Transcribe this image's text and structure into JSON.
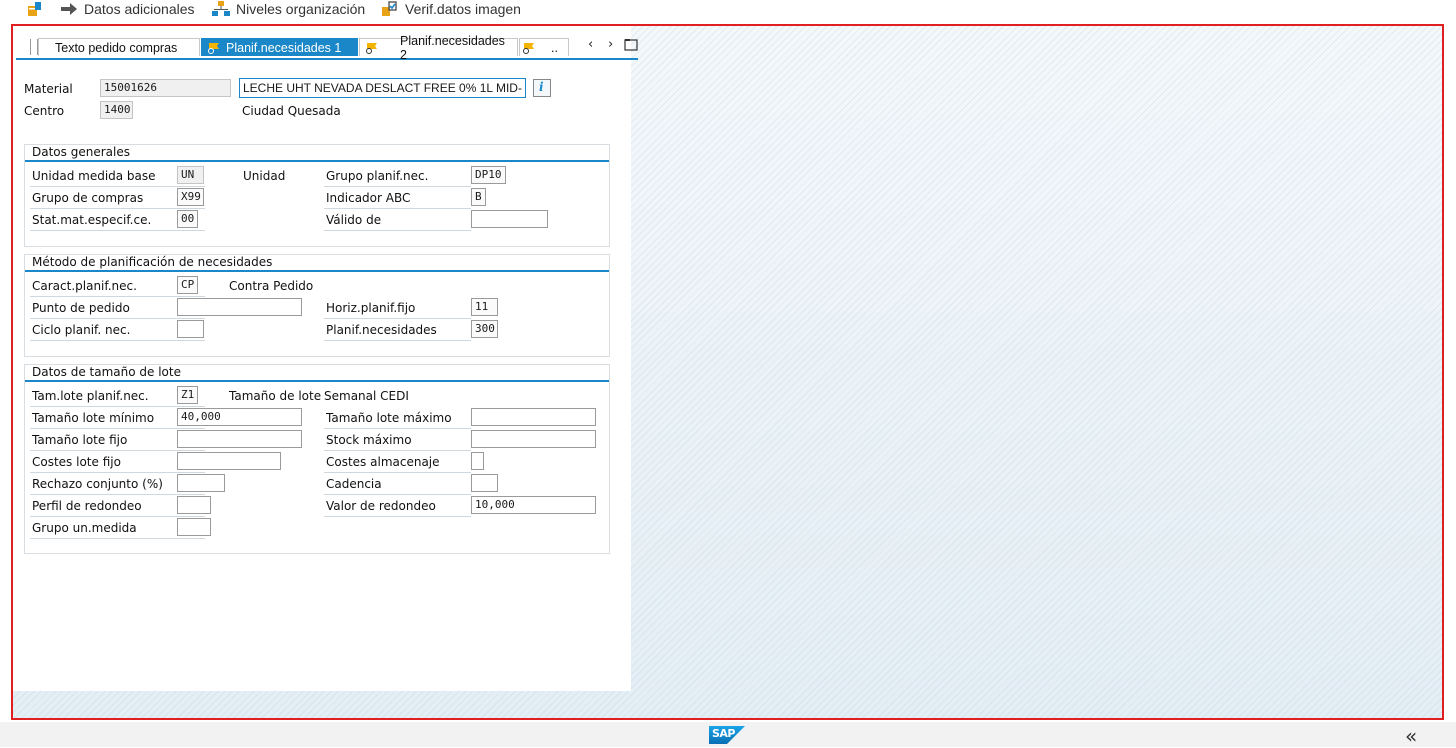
{
  "toolbar": {
    "btn0_label": "",
    "btn1_label": "Datos adicionales",
    "btn2_label": "Niveles organización",
    "btn3_label": "Verif.datos imagen"
  },
  "tabs": [
    {
      "label": "Texto pedido compras",
      "active": false
    },
    {
      "label": "Planif.necesidades 1",
      "active": true
    },
    {
      "label": "Planif.necesidades 2",
      "active": false
    },
    {
      "label": "..",
      "active": false
    }
  ],
  "header": {
    "material_label": "Material",
    "material_value": "15001626",
    "material_desc": "LECHE UHT NEVADA DESLACT FREE 0% 1L MID-",
    "centro_label": "Centro",
    "centro_value": "1400",
    "centro_desc": "Ciudad Quesada"
  },
  "datos_generales": {
    "title": "Datos generales",
    "umb_label": "Unidad medida base",
    "umb_value": "UN",
    "umb_desc": "Unidad",
    "gpn_label": "Grupo planif.nec.",
    "gpn_value": "DP10",
    "gc_label": "Grupo de compras",
    "gc_value": "X99",
    "abc_label": "Indicador ABC",
    "abc_value": "B",
    "stat_label": "Stat.mat.especif.ce.",
    "stat_value": "00",
    "valido_label": "Válido de",
    "valido_value": ""
  },
  "metodo": {
    "title": "Método de planificación de necesidades",
    "caract_label": "Caract.planif.nec.",
    "caract_value": "CP",
    "caract_desc": "Contra Pedido",
    "punto_label": "Punto de pedido",
    "punto_value": "",
    "horiz_label": "Horiz.planif.fijo",
    "horiz_value": "11",
    "ciclo_label": "Ciclo planif. nec.",
    "ciclo_value": "",
    "planif_label": "Planif.necesidades",
    "planif_value": "300"
  },
  "lote": {
    "title": "Datos de tamaño de lote",
    "tam_label": "Tam.lote planif.nec.",
    "tam_value": "Z1",
    "tam_desc_a": "Tamaño de lote",
    "tam_desc_b": "Semanal CEDI",
    "min_label": "Tamaño lote mínimo",
    "min_value": "40,000",
    "max_label": "Tamaño lote máximo",
    "max_value": "",
    "fijo_label": "Tamaño lote fijo",
    "fijo_value": "",
    "stock_label": "Stock máximo",
    "stock_value": "",
    "costes_label": "Costes lote fijo",
    "costes_value": "",
    "alm_label": "Costes almacenaje",
    "alm_value": "",
    "rech_label": "Rechazo conjunto (%)",
    "rech_value": "",
    "cad_label": "Cadencia",
    "cad_value": "",
    "perfil_label": "Perfil de redondeo",
    "perfil_value": "",
    "valor_label": "Valor de redondeo",
    "valor_value": "10,000",
    "grupo_label": "Grupo un.medida",
    "grupo_value": ""
  },
  "footer": {
    "logo_text": "SAP",
    "collapse_glyph": "«"
  },
  "colors": {
    "accent": "#1a87c8",
    "frame_border": "#e02020",
    "flag": "#f2b400"
  }
}
